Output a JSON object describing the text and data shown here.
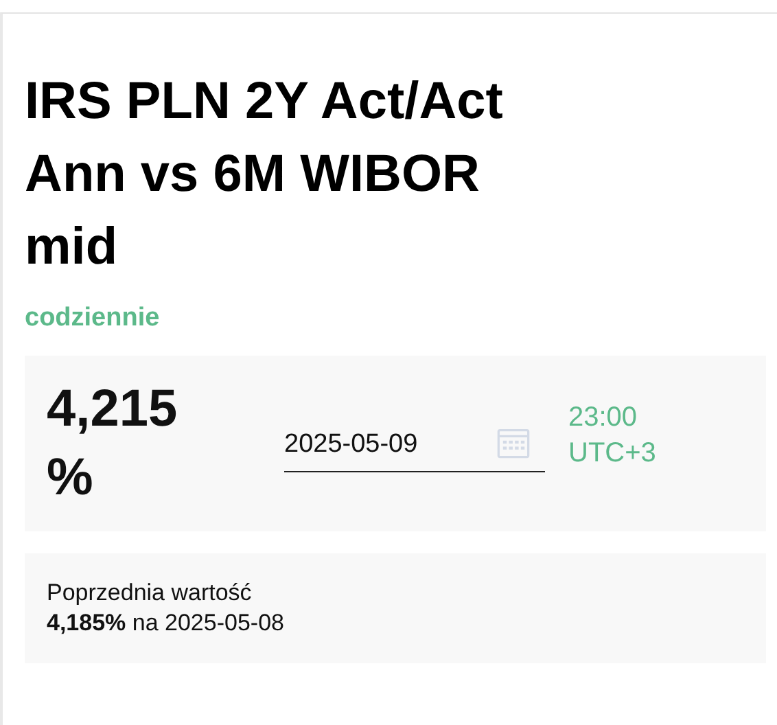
{
  "title": "IRS PLN 2Y Act/Act Ann vs 6M WIBOR mid",
  "frequency": "codziennie",
  "current": {
    "value": "4,215",
    "unit": "%",
    "date": "2025-05-09",
    "time": "23:00",
    "timezone": "UTC+3"
  },
  "previous": {
    "label": "Poprzednia wartość",
    "text": "**4,185%** na 2025-05-08"
  }
}
